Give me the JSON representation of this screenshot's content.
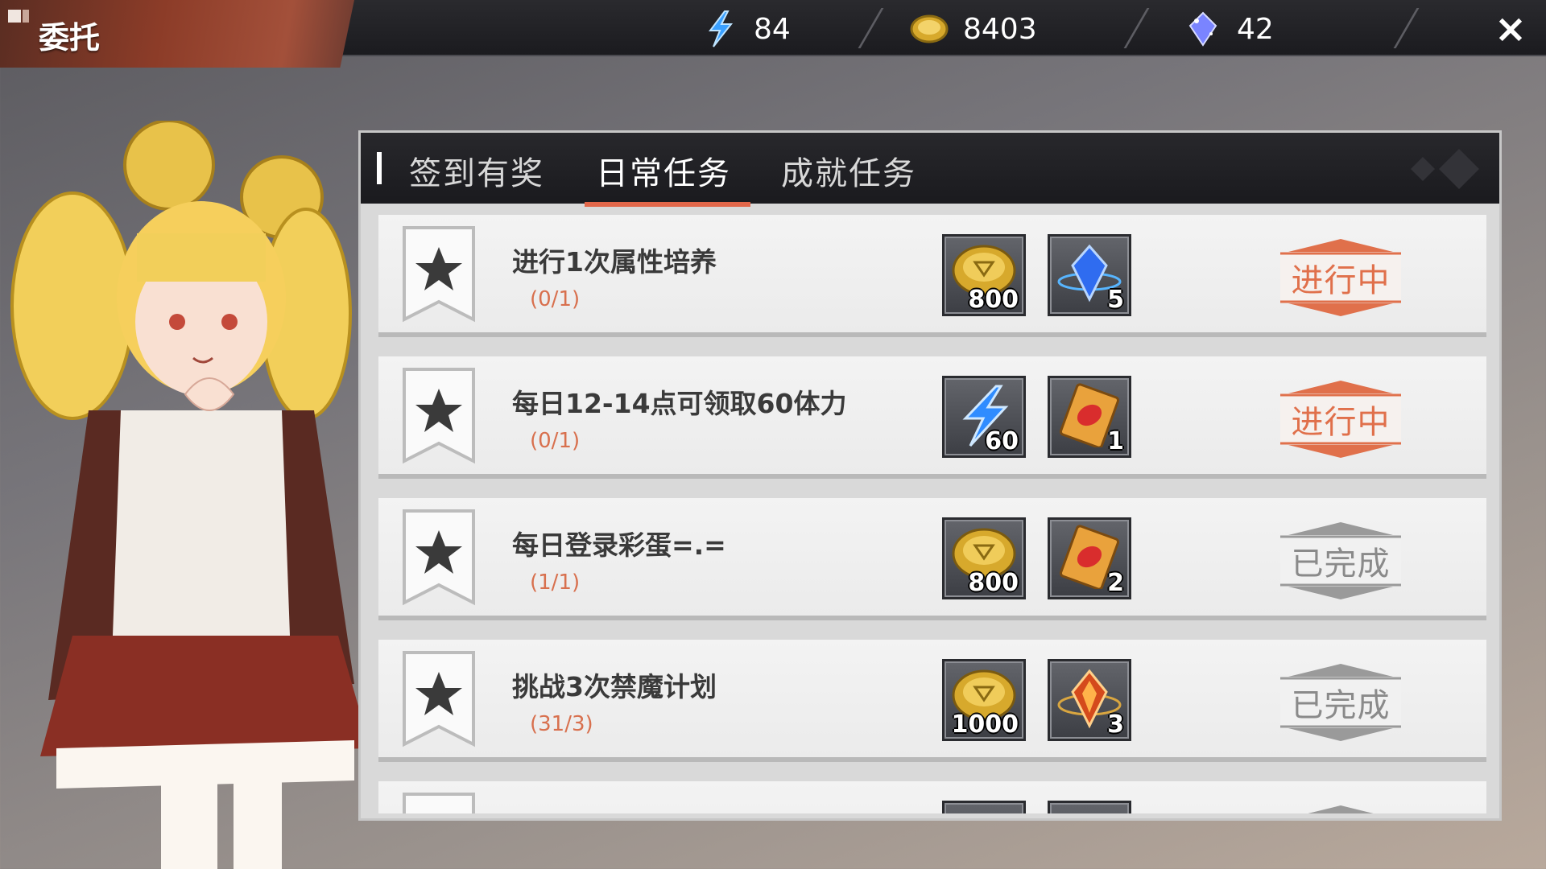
{
  "header": {
    "title": "委托",
    "resources": [
      {
        "icon": "stamina-lightning-icon",
        "value": "84"
      },
      {
        "icon": "gold-coin-icon",
        "value": "8403"
      },
      {
        "icon": "crystal-icon",
        "value": "42"
      }
    ],
    "close_label": "×"
  },
  "tabs": [
    {
      "label": "签到有奖",
      "active": false
    },
    {
      "label": "日常任务",
      "active": true
    },
    {
      "label": "成就任务",
      "active": false
    }
  ],
  "tasks": [
    {
      "name": "进行1次属性培养",
      "progress": "(0/1)",
      "rewards": [
        {
          "icon": "gold-coin-icon",
          "qty": "800"
        },
        {
          "icon": "blue-crystal-icon",
          "qty": "5"
        }
      ],
      "status": "进行中",
      "status_type": "progress"
    },
    {
      "name": "每日12-14点可领取60体力",
      "progress": "(0/1)",
      "rewards": [
        {
          "icon": "stamina-lightning-icon",
          "qty": "60"
        },
        {
          "icon": "red-card-icon",
          "qty": "1"
        }
      ],
      "status": "进行中",
      "status_type": "progress"
    },
    {
      "name": "每日登录彩蛋=.=",
      "progress": "(1/1)",
      "rewards": [
        {
          "icon": "gold-coin-icon",
          "qty": "800"
        },
        {
          "icon": "red-card-icon",
          "qty": "2"
        }
      ],
      "status": "已完成",
      "status_type": "done"
    },
    {
      "name": "挑战3次禁魔计划",
      "progress": "(31/3)",
      "rewards": [
        {
          "icon": "gold-coin-icon",
          "qty": "1000"
        },
        {
          "icon": "fire-crystal-icon",
          "qty": "3"
        }
      ],
      "status": "已完成",
      "status_type": "done"
    }
  ],
  "colors": {
    "accent": "#e2674a",
    "progress_text": "#e0704b",
    "done_text": "#8a8a8a"
  }
}
